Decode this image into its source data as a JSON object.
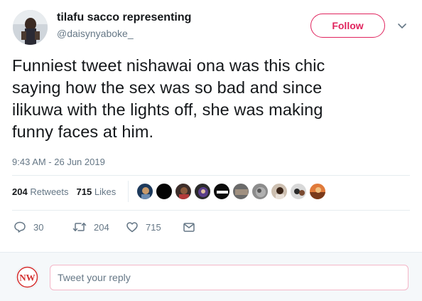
{
  "author": {
    "name": "tilafu sacco representing",
    "handle": "@daisynyaboke_"
  },
  "follow_button": {
    "label": "Follow",
    "color": "#e0245e"
  },
  "tweet": {
    "lines": [
      "Funniest tweet nishawai ona was this chic",
      "saying how the sex was so bad and since",
      "ilikuwa with the lights off, she was making",
      "funny faces at him."
    ],
    "timestamp": "9:43 AM - 26 Jun 2019"
  },
  "stats": {
    "retweets_count": "204",
    "retweets_label": "Retweets",
    "likes_count": "715",
    "likes_label": "Likes"
  },
  "actions": {
    "reply_count": "30",
    "retweet_count": "204",
    "like_count": "715"
  },
  "reply": {
    "placeholder": "Tweet your reply",
    "avatar_text": "NW"
  },
  "colors": {
    "text_primary": "#14171a",
    "text_secondary": "#657786",
    "accent": "#e0245e",
    "divider": "#e6ecf0",
    "reply_bg": "#f5f8fa"
  }
}
